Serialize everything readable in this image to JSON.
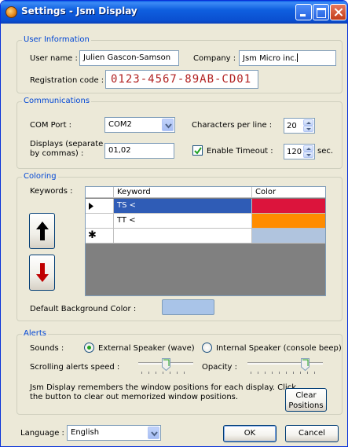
{
  "window": {
    "title": "Settings - Jsm Display"
  },
  "user_info": {
    "legend": "User Information",
    "username_label": "User name :",
    "username_value": "Julien Gascon-Samson",
    "company_label": "Company :",
    "company_value": "Jsm Micro inc.",
    "regcode_label": "Registration code :",
    "regcode_value": "0123-4567-89AB-CD01"
  },
  "communications": {
    "legend": "Communications",
    "com_port_label": "COM Port :",
    "com_port_value": "COM2",
    "chars_per_line_label": "Characters per line :",
    "chars_per_line_value": "20",
    "displays_label_line1": "Displays (separate",
    "displays_label_line2": "by commas) :",
    "displays_value": "01,02",
    "enable_timeout_label": "Enable Timeout :",
    "enable_timeout_checked": true,
    "timeout_value": "120",
    "timeout_unit": "sec."
  },
  "coloring": {
    "legend": "Coloring",
    "keywords_label": "Keywords :",
    "columns": [
      "Keyword",
      "Color"
    ],
    "rows": [
      {
        "keyword": "TS <",
        "color": "#dc143c",
        "selected": true
      },
      {
        "keyword": "TT <",
        "color": "#ff8c00",
        "selected": false
      },
      {
        "keyword": "",
        "color": "#b0c4de",
        "selected": false,
        "new_row": true
      }
    ],
    "move_up_icon": "up-arrow-icon",
    "move_down_icon": "down-arrow-icon",
    "default_bg_label": "Default Background Color :",
    "default_bg_color": "#a9c4e8"
  },
  "alerts": {
    "legend": "Alerts",
    "sounds_label": "Sounds :",
    "external_speaker_label": "External Speaker (wave)",
    "internal_speaker_label": "Internal Speaker (console beep)",
    "sound_selected": "external",
    "scroll_speed_label": "Scrolling alerts speed :",
    "scroll_speed_level": 0.5,
    "opacity_label": "Opacity :",
    "opacity_level": 0.8,
    "info_line1": "Jsm Display remembers the window positions for each display. Click",
    "info_line2": "the button to clear out memorized window positions.",
    "clear_button_line1": "Clear",
    "clear_button_line2": "Positions"
  },
  "footer": {
    "language_label": "Language :",
    "language_value": "English",
    "ok_label": "OK",
    "cancel_label": "Cancel"
  },
  "colors": {
    "titlebar": "#0a4fd0",
    "group_legend": "#0046d5",
    "regcode_text": "#b22222",
    "grid_selection": "#2f5cb6",
    "grid_background": "#808080"
  }
}
